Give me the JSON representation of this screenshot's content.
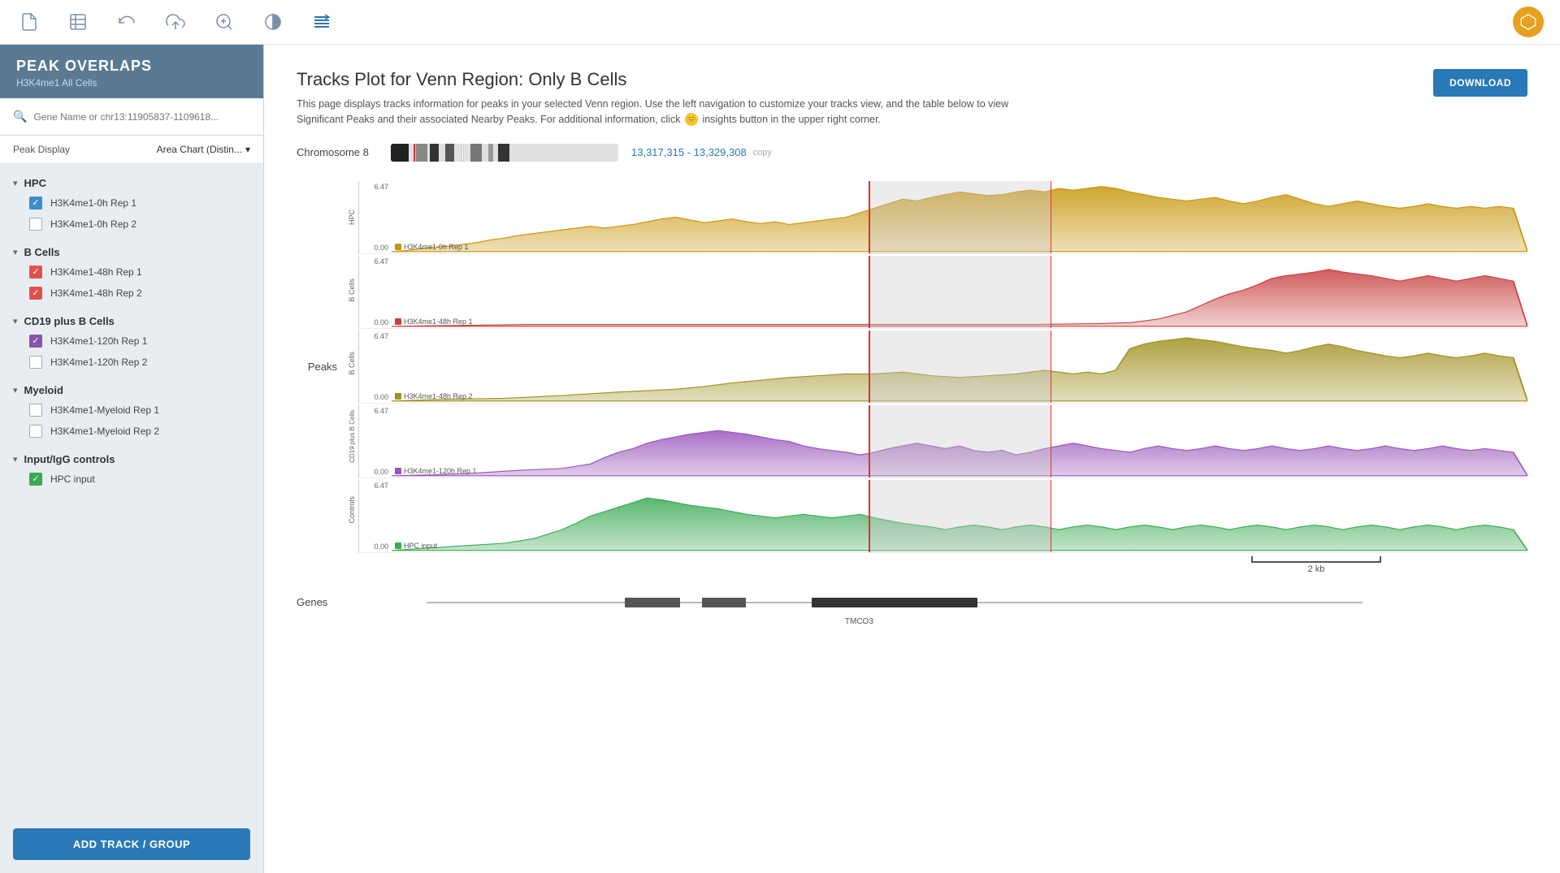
{
  "toolbar": {
    "icons": [
      {
        "name": "document-icon",
        "symbol": "📄",
        "active": false
      },
      {
        "name": "table-icon",
        "symbol": "📊",
        "active": false
      },
      {
        "name": "undo-icon",
        "symbol": "↺",
        "active": false
      },
      {
        "name": "cloud-upload-icon",
        "symbol": "☁",
        "active": false
      },
      {
        "name": "search-zoom-icon",
        "symbol": "🔍",
        "active": false
      },
      {
        "name": "contrast-icon",
        "symbol": "◑",
        "active": false
      },
      {
        "name": "tracks-icon",
        "symbol": "≋",
        "active": true
      }
    ],
    "app_icon": "⬡"
  },
  "sidebar": {
    "title": "PEAK OVERLAPS",
    "subtitle": "H3K4me1 All Cells",
    "search_placeholder": "Gene Name or chr13:11905837-1109618...",
    "peak_display_label": "Peak Display",
    "peak_display_value": "Area Chart (Distin...",
    "groups": [
      {
        "name": "HPC",
        "collapsed": false,
        "tracks": [
          {
            "name": "H3K4me1-0h Rep 1",
            "checked": true,
            "color": "blue"
          },
          {
            "name": "H3K4me1-0h Rep 2",
            "checked": false,
            "color": "none"
          }
        ]
      },
      {
        "name": "B Cells",
        "collapsed": false,
        "tracks": [
          {
            "name": "H3K4me1-48h Rep 1",
            "checked": true,
            "color": "red"
          },
          {
            "name": "H3K4me1-48h Rep 2",
            "checked": true,
            "color": "red"
          }
        ]
      },
      {
        "name": "CD19 plus B Cells",
        "collapsed": false,
        "tracks": [
          {
            "name": "H3K4me1-120h Rep 1",
            "checked": true,
            "color": "purple"
          },
          {
            "name": "H3K4me1-120h Rep 2",
            "checked": false,
            "color": "none"
          }
        ]
      },
      {
        "name": "Myeloid",
        "collapsed": false,
        "tracks": [
          {
            "name": "H3K4me1-Myeloid Rep 1",
            "checked": false,
            "color": "none"
          },
          {
            "name": "H3K4me1-Myeloid Rep 2",
            "checked": false,
            "color": "none"
          }
        ]
      },
      {
        "name": "Input/IgG controls",
        "collapsed": false,
        "tracks": [
          {
            "name": "HPC input",
            "checked": true,
            "color": "green"
          }
        ]
      }
    ],
    "add_track_label": "ADD TRACK / GROUP"
  },
  "main": {
    "page_title": "Tracks Plot for Venn Region: Only B Cells",
    "page_desc": "This page displays tracks information for peaks in your selected Venn region. Use the left navigation to customize your tracks view, and the table below to view Significant Peaks and their associated Nearby Peaks. For additional information, click",
    "page_desc2": "insights button in the upper right corner.",
    "download_label": "DOWNLOAD",
    "chromosome": {
      "label": "Chromosome 8",
      "position": "13,317,315 - 13,329,308",
      "copy_label": "copy"
    },
    "tracks_label": "Peaks",
    "y_max": "6.47",
    "y_min": "0.00",
    "track_groups": [
      {
        "side_label": "HPC",
        "color": "#c8960c",
        "legend": "H3K4me1-0h Rep 1",
        "show": true
      },
      {
        "side_label": "B Cells",
        "color": "#c84040",
        "legend": "H3K4me1-48h Rep 1",
        "show": true
      },
      {
        "side_label": "B Cells",
        "color": "#a09020",
        "legend": "H3K4me1-48h Rep 2",
        "show": true
      },
      {
        "side_label": "CD19 plus B Cells",
        "color": "#9955bb",
        "legend": "H3K4me1-120h Rep 1",
        "show": true
      },
      {
        "side_label": "Controls",
        "color": "#3aaa55",
        "legend": "HPC input",
        "show": true
      }
    ],
    "scale_label": "2 kb",
    "genes_label": "Genes",
    "gene_name": "TMCO3",
    "highlight_start_pct": 42,
    "highlight_end_pct": 58
  }
}
